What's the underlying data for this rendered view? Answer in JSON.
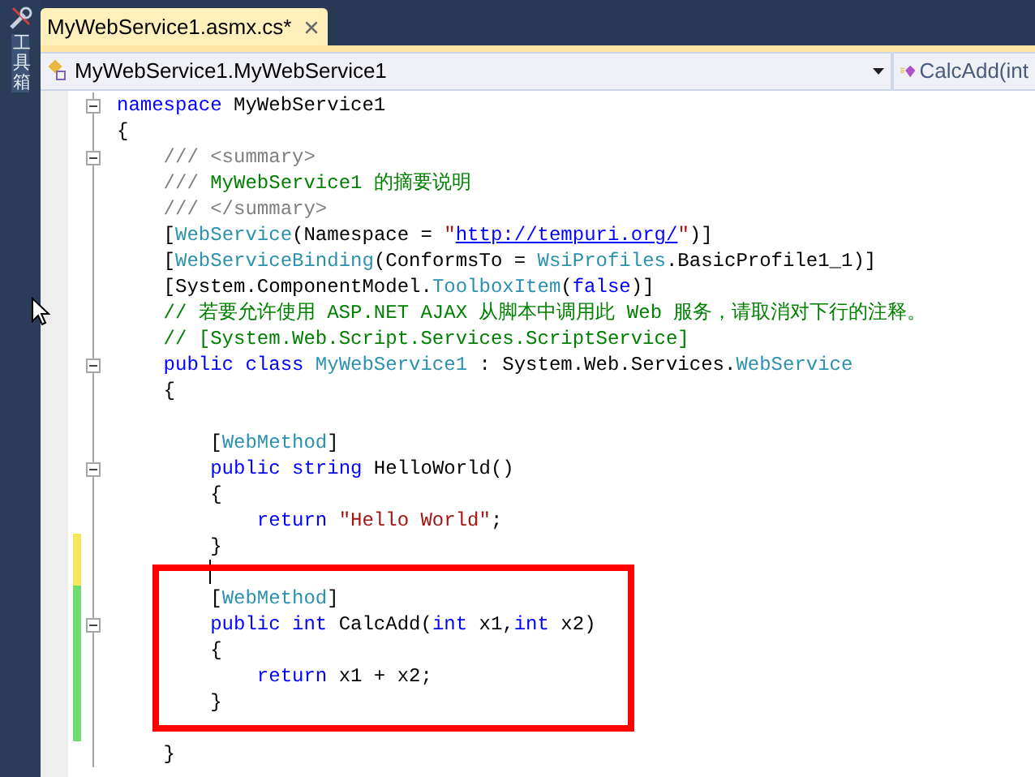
{
  "toolbox": {
    "label": "工具箱"
  },
  "tabs": [
    {
      "label": "MyWebService1.asmx.cs*",
      "selected": true
    }
  ],
  "navigation": {
    "type_dropdown": "MyWebService1.MyWebService1",
    "member_dropdown": "CalcAdd(int"
  },
  "editor": {
    "lines": [
      {
        "changed": false,
        "fold": true,
        "tokens": [
          {
            "text": "namespace",
            "kind": "keyword"
          },
          {
            "text": " MyWebService1",
            "kind": "plain"
          }
        ]
      },
      {
        "changed": false,
        "tokens": [
          {
            "text": "{",
            "kind": "plain"
          }
        ]
      },
      {
        "changed": false,
        "fold": true,
        "tokens": [
          {
            "text": "    /// <summary>",
            "kind": "doc"
          }
        ]
      },
      {
        "changed": false,
        "tokens": [
          {
            "text": "    /// ",
            "kind": "doc"
          },
          {
            "text": "MyWebService1 的摘要说明",
            "kind": "comment"
          }
        ]
      },
      {
        "changed": false,
        "tokens": [
          {
            "text": "    /// </summary>",
            "kind": "doc"
          }
        ]
      },
      {
        "changed": false,
        "tokens": [
          {
            "text": "    [",
            "kind": "plain"
          },
          {
            "text": "WebService",
            "kind": "type"
          },
          {
            "text": "(Namespace = ",
            "kind": "plain"
          },
          {
            "text": "\"",
            "kind": "string"
          },
          {
            "text": "http://tempuri.org/",
            "kind": "link"
          },
          {
            "text": "\"",
            "kind": "string"
          },
          {
            "text": ")]",
            "kind": "plain"
          }
        ]
      },
      {
        "changed": false,
        "tokens": [
          {
            "text": "    [",
            "kind": "plain"
          },
          {
            "text": "WebServiceBinding",
            "kind": "type"
          },
          {
            "text": "(ConformsTo = ",
            "kind": "plain"
          },
          {
            "text": "WsiProfiles",
            "kind": "type"
          },
          {
            "text": ".BasicProfile1_1)]",
            "kind": "plain"
          }
        ]
      },
      {
        "changed": false,
        "tokens": [
          {
            "text": "    [System.ComponentModel.",
            "kind": "plain"
          },
          {
            "text": "ToolboxItem",
            "kind": "type"
          },
          {
            "text": "(",
            "kind": "plain"
          },
          {
            "text": "false",
            "kind": "keyword"
          },
          {
            "text": ")]",
            "kind": "plain"
          }
        ]
      },
      {
        "changed": false,
        "tokens": [
          {
            "text": "    // 若要允许使用 ASP.NET AJAX 从脚本中调用此 Web 服务，请取消对下行的注释。",
            "kind": "comment"
          }
        ]
      },
      {
        "changed": false,
        "tokens": [
          {
            "text": "    // [System.Web.Script.Services.ScriptService]",
            "kind": "comment"
          }
        ]
      },
      {
        "changed": false,
        "fold": true,
        "tokens": [
          {
            "text": "    public class",
            "kind": "keyword"
          },
          {
            "text": " MyWebService1",
            "kind": "type"
          },
          {
            "text": " : System.Web.Services.",
            "kind": "plain"
          },
          {
            "text": "WebService",
            "kind": "type"
          }
        ]
      },
      {
        "changed": false,
        "tokens": [
          {
            "text": "    {",
            "kind": "plain"
          }
        ]
      },
      {
        "changed": false
      },
      {
        "changed": false,
        "tokens": [
          {
            "text": "        [",
            "kind": "plain"
          },
          {
            "text": "WebMethod",
            "kind": "type"
          },
          {
            "text": "]",
            "kind": "plain"
          }
        ]
      },
      {
        "changed": false,
        "fold": true,
        "tokens": [
          {
            "text": "        public string",
            "kind": "keyword"
          },
          {
            "text": " HelloWorld()",
            "kind": "plain"
          }
        ]
      },
      {
        "changed": false,
        "tokens": [
          {
            "text": "        {",
            "kind": "plain"
          }
        ]
      },
      {
        "changed": false,
        "tokens": [
          {
            "text": "            return",
            "kind": "keyword"
          },
          {
            "text": " \"Hello World\"",
            "kind": "string"
          },
          {
            "text": ";",
            "kind": "plain"
          }
        ]
      },
      {
        "changed": true,
        "saved": false,
        "tokens": [
          {
            "text": "        }",
            "kind": "plain"
          }
        ]
      },
      {
        "changed": true,
        "saved": false,
        "caret": true
      },
      {
        "changed": true,
        "saved": true,
        "tokens": [
          {
            "text": "        [",
            "kind": "plain"
          },
          {
            "text": "WebMethod",
            "kind": "type"
          },
          {
            "text": "]",
            "kind": "plain"
          }
        ]
      },
      {
        "changed": true,
        "saved": true,
        "fold": true,
        "tokens": [
          {
            "text": "        public int",
            "kind": "keyword"
          },
          {
            "text": " CalcAdd(",
            "kind": "plain"
          },
          {
            "text": "int",
            "kind": "keyword"
          },
          {
            "text": " x1,",
            "kind": "plain"
          },
          {
            "text": "int",
            "kind": "keyword"
          },
          {
            "text": " x2)",
            "kind": "plain"
          }
        ]
      },
      {
        "changed": true,
        "saved": true,
        "tokens": [
          {
            "text": "        {",
            "kind": "plain"
          }
        ]
      },
      {
        "changed": true,
        "saved": true,
        "tokens": [
          {
            "text": "            return",
            "kind": "keyword"
          },
          {
            "text": " x1 + x2;",
            "kind": "plain"
          }
        ]
      },
      {
        "changed": true,
        "saved": true,
        "tokens": [
          {
            "text": "        }",
            "kind": "plain"
          }
        ]
      },
      {
        "changed": true,
        "saved": true
      },
      {
        "changed": false,
        "tokens": [
          {
            "text": "    }",
            "kind": "plain"
          }
        ]
      }
    ]
  }
}
